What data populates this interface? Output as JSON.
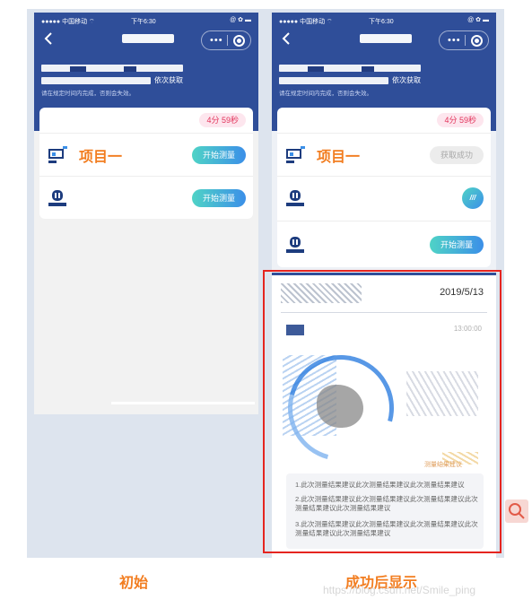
{
  "status": {
    "carrier": "●●●●● 中国移动 ⌔",
    "time": "下午6:30",
    "right": "@ ✿ ▬"
  },
  "header": {
    "retry": "依次获取",
    "hint": "请在规定时间内完成，否则会失效。"
  },
  "left": {
    "timer": "4分 59秒",
    "items": [
      {
        "label": "项目一",
        "button": "开始测量"
      },
      {
        "label": "",
        "button": "开始测量"
      }
    ]
  },
  "right": {
    "timer": "4分 59秒",
    "items": [
      {
        "label": "项目一",
        "button": "获取成功"
      },
      {
        "label": "",
        "badge": "///"
      },
      {
        "label": "",
        "button": "开始测量"
      }
    ],
    "result": {
      "date": "2019/5/13",
      "time": "13:00:00",
      "advice_tag": "测量结果建议",
      "advice": [
        "1.此次测量结果建议此次测量结果建议此次测量结果建议",
        "2.此次测量结果建议此次测量结果建议此次测量结果建议此次测量结果建议此次测量结果建议",
        "3.此次测量结果建议此次测量结果建议此次测量结果建议此次测量结果建议此次测量结果建议"
      ]
    }
  },
  "captions": {
    "initial": "初始",
    "after": "成功后显示"
  },
  "watermark": "https://blog.csdn.net/Smile_ping",
  "colors": {
    "header_blue": "#2f4e99",
    "accent_orange": "#f27d20",
    "timer_red": "#e2335a",
    "highlight_red": "#e52520"
  }
}
